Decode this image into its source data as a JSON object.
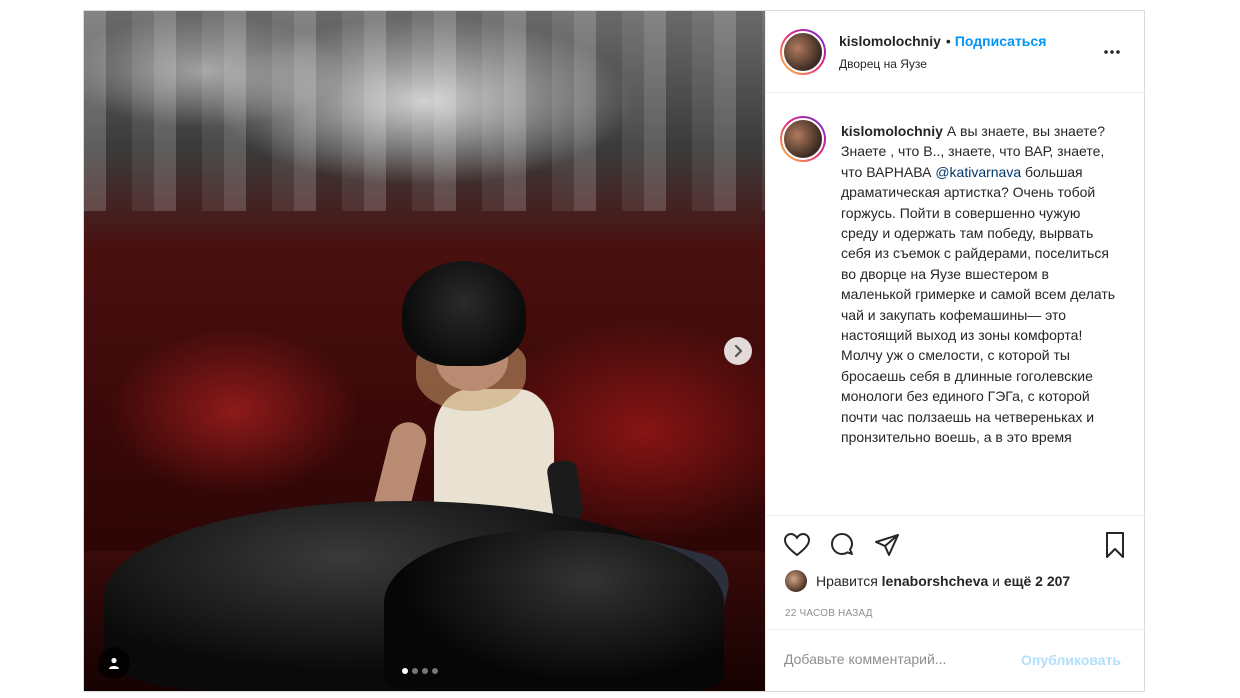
{
  "header": {
    "username": "kislomolochniy",
    "separator": "•",
    "follow_label": "Подписаться",
    "location": "Дворец на Яузе",
    "more_icon": "more-horizontal-icon"
  },
  "caption": {
    "username": "kislomolochniy",
    "text_before_mention": "А вы знаете, вы знаете? Знаете , что В.., знаете, что ВАР, знаете, что ВАРНАВА ",
    "mention": "@kativarnava",
    "text_after_mention": " большая драматическая артистка? Очень тобой горжусь. Пойти в совершенно чужую среду и одержать там победу, вырвать себя из съемок с райдерами, поселиться во дворце на Яузе вшестером в маленькой гримерке и самой всем делать чай и закупать кофемашины— это настоящий выход из зоны комфорта! Молчу уж о смелости, с которой ты бросаешь себя в длинные гоголевские монологи без единого ГЭГа, с которой почти час ползаешь на четвереньках и пронзительно воешь, а в это время"
  },
  "actions": {
    "icons": [
      "heart-icon",
      "comment-icon",
      "share-icon",
      "bookmark-icon"
    ]
  },
  "likes": {
    "prefix": "Нравится",
    "user": "lenaborshcheva",
    "joiner": "и",
    "count_text": "ещё 2 207"
  },
  "timestamp": "22 часов назад",
  "comment": {
    "placeholder": "Добавьте комментарий...",
    "publish_label": "Опубликовать"
  },
  "carousel": {
    "slide_count": 4,
    "active_index": 0
  }
}
